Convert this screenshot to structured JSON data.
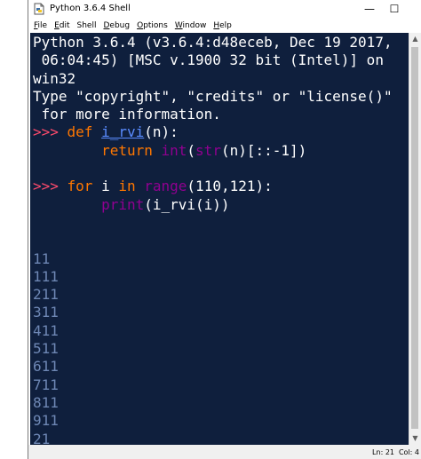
{
  "window": {
    "title": "Python 3.6.4 Shell",
    "controls": {
      "minimize": "—",
      "maximize": "☐",
      "close": "✕"
    }
  },
  "menu": {
    "items": [
      {
        "underline": "F",
        "rest": "ile"
      },
      {
        "underline": "E",
        "rest": "dit"
      },
      {
        "underline": "",
        "rest": "Shell"
      },
      {
        "underline": "D",
        "rest": "ebug"
      },
      {
        "underline": "O",
        "rest": "ptions"
      },
      {
        "underline": "W",
        "rest": "indow"
      },
      {
        "underline": "H",
        "rest": "elp"
      }
    ]
  },
  "shell": {
    "banner": [
      "Python 3.6.4 (v3.6.4:d48eceb, Dec 19 2017,",
      " 06:04:45) [MSC v.1900 32 bit (Intel)] on",
      "win32",
      "Type \"copyright\", \"credits\" or \"license()\"",
      " for more information."
    ],
    "prompt": ">>> ",
    "def_line": {
      "kw": "def",
      "name": "i_rvi",
      "rest": "(n):"
    },
    "return_line": {
      "indent": "        ",
      "kw": "return",
      "sp": " ",
      "b1": "int",
      "p1": "(",
      "b2": "str",
      "rest": "(n)[::-1])"
    },
    "for_line": {
      "kw": "for",
      "mid1": " i ",
      "kw2": "in",
      "sp": " ",
      "b": "range",
      "rest": "(110,121):"
    },
    "print_line": {
      "indent": "        ",
      "b": "print",
      "rest": "(i_rvi(i))"
    },
    "output": [
      "11",
      "111",
      "211",
      "311",
      "411",
      "511",
      "611",
      "711",
      "811",
      "911",
      "21"
    ],
    "final_prompt": ">>>"
  },
  "status": {
    "line": "Ln: 21",
    "col": "Col: 4"
  },
  "colors": {
    "background": "#0f1f3d",
    "keyword": "#ff7700",
    "builtin": "#900090",
    "defname": "#5a8cff",
    "prompt": "#ff4b6c",
    "output": "#6e87b4"
  }
}
